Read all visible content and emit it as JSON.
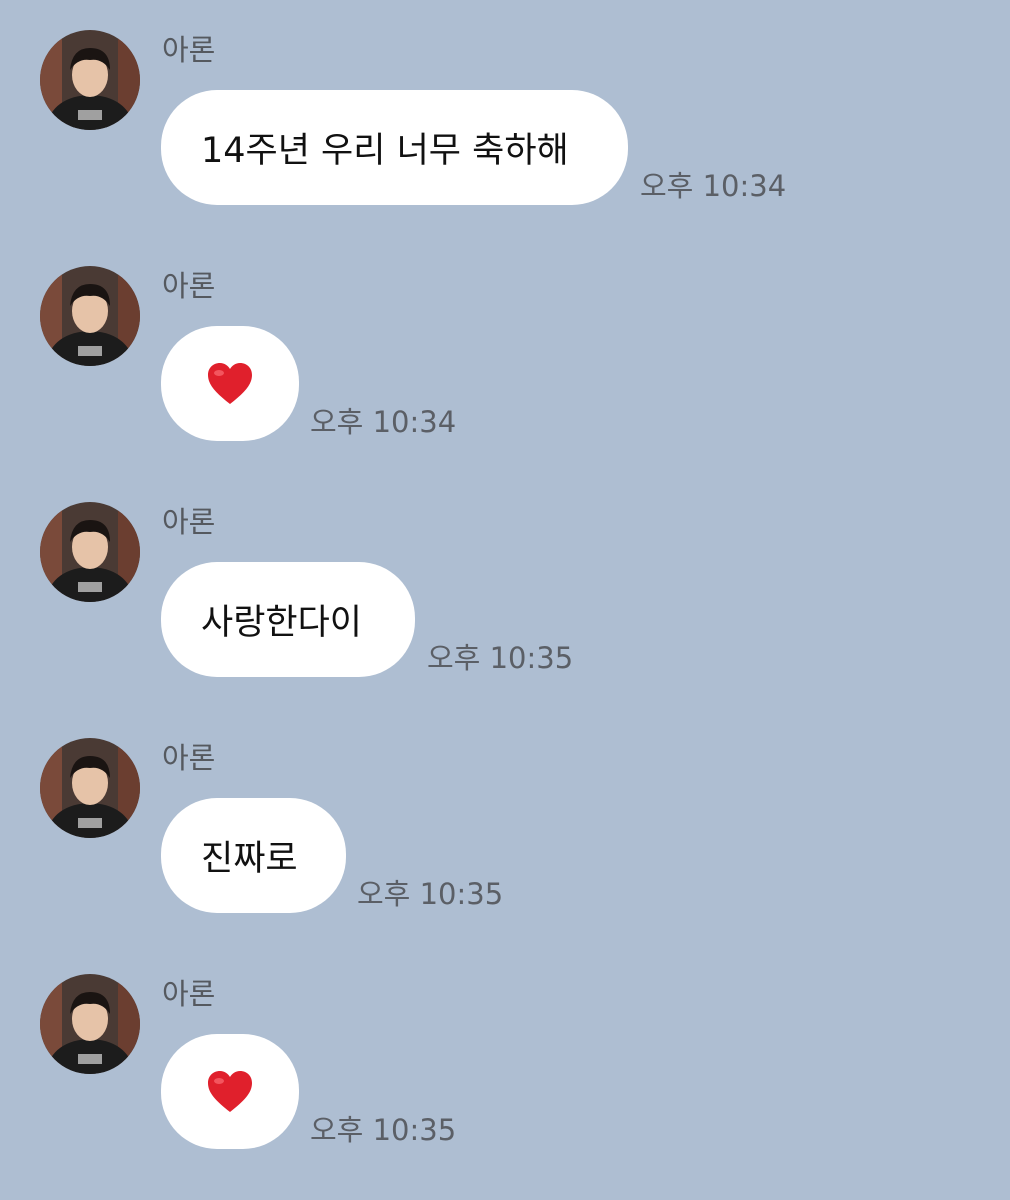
{
  "chat": {
    "background": "#aebed2",
    "messages": [
      {
        "sender": "아론",
        "type": "text",
        "text": "14주년 우리 너무 축하해",
        "time": "오후 10:34"
      },
      {
        "sender": "아론",
        "type": "emoji",
        "emoji": "heart-icon",
        "time": "오후 10:34"
      },
      {
        "sender": "아론",
        "type": "text",
        "text": "사랑한다이",
        "time": "오후 10:35"
      },
      {
        "sender": "아론",
        "type": "text",
        "text": "진짜로",
        "time": "오후 10:35"
      },
      {
        "sender": "아론",
        "type": "emoji",
        "emoji": "heart-icon",
        "time": "오후 10:35"
      }
    ]
  },
  "colors": {
    "bubble": "#ffffff",
    "heart": "#e0202c",
    "name_text": "#55595f",
    "time_text": "#5b5f66"
  }
}
